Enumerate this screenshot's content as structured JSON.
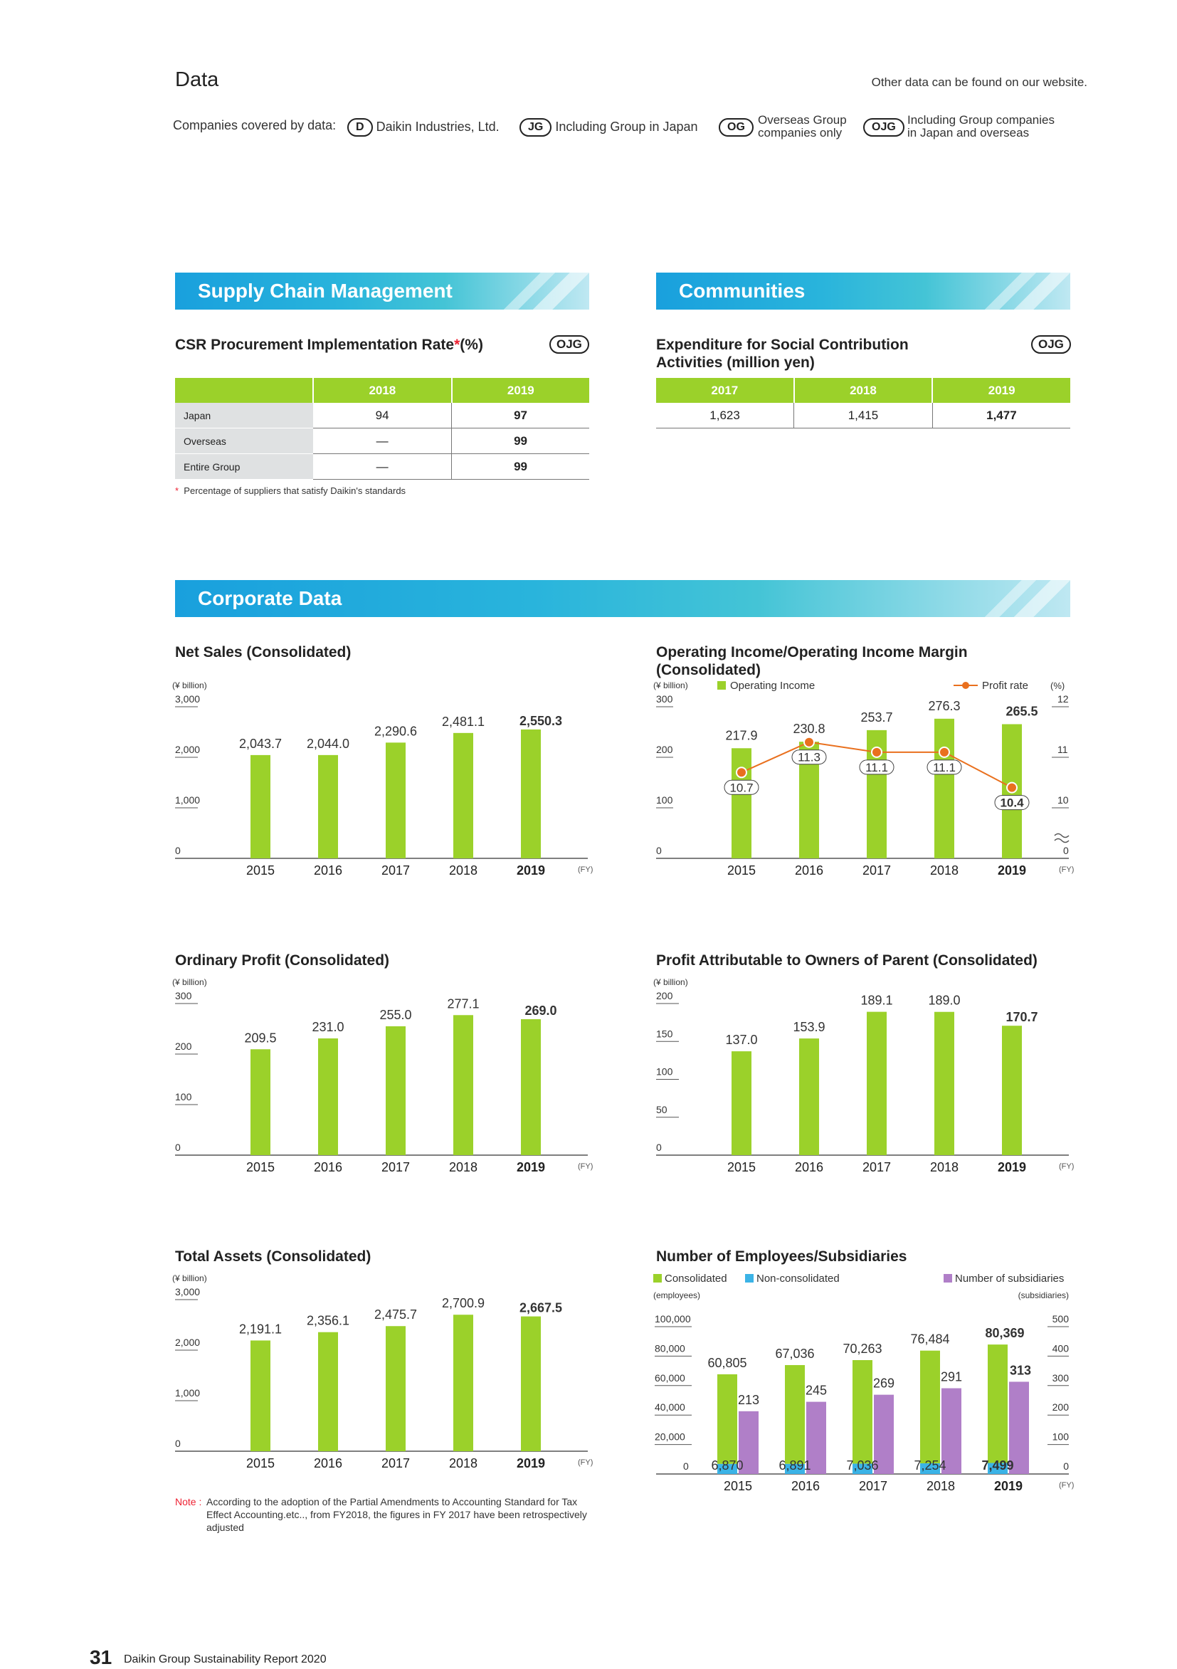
{
  "header": {
    "title": "Data",
    "website_note": "Other data can be found on our website.",
    "coverage_label": "Companies covered by data:",
    "legend": [
      {
        "badge": "D",
        "text": "Daikin Industries, Ltd."
      },
      {
        "badge": "JG",
        "text": "Including Group in Japan"
      },
      {
        "badge": "OG",
        "text1": "Overseas Group",
        "text2": "companies only"
      },
      {
        "badge": "OJG",
        "text1": "Including Group companies",
        "text2": "in Japan and overseas"
      }
    ]
  },
  "supply_chain": {
    "banner": "Supply Chain Management",
    "title": "CSR Procurement Implementation Rate",
    "title_ast": "*",
    "title_unit": "(%)",
    "badge": "OJG",
    "columns": [
      "2018",
      "2019"
    ],
    "rows": [
      {
        "label": "Japan",
        "v2018": "94",
        "v2019": "97"
      },
      {
        "label": "Overseas",
        "v2018": "—",
        "v2019": "99"
      },
      {
        "label": "Entire Group",
        "v2018": "—",
        "v2019": "99"
      }
    ],
    "footnote_ast": "*",
    "footnote": "Percentage of suppliers that satisfy Daikin's standards"
  },
  "communities": {
    "banner": "Communities",
    "title_line1": "Expenditure for Social Contribution",
    "title_line2": "Activities (million yen)",
    "badge": "OJG",
    "columns": [
      "2017",
      "2018",
      "2019"
    ],
    "values": [
      "1,623",
      "1,415",
      "1,477"
    ]
  },
  "corporate": {
    "banner": "Corporate Data",
    "note_label": "Note :",
    "note_line1": "According to the adoption of the Partial Amendments to Accounting Standard for Tax",
    "note_line2": "Effect Accounting.etc.., from FY2018, the figures in FY 2017 have been retrospectively",
    "note_line3": "adjusted"
  },
  "colors": {
    "green": "#9bd12a",
    "blue": "#3bb3e6",
    "purple": "#b07fc8",
    "orange": "#e9701e"
  },
  "chart_data": [
    {
      "id": "net_sales",
      "type": "bar",
      "title": "Net Sales (Consolidated)",
      "ylabel": "(¥ billion)",
      "xunit": "(FY)",
      "categories": [
        "2015",
        "2016",
        "2017",
        "2018",
        "2019"
      ],
      "values": [
        2043.7,
        2044.0,
        2290.6,
        2481.1,
        2550.3
      ],
      "labels": [
        "2,043.7",
        "2,044.0",
        "2,290.6",
        "2,481.1",
        "2,550.3"
      ],
      "ylim": [
        0,
        3000
      ],
      "yticks": [
        0,
        1000,
        2000,
        3000
      ],
      "ytick_labels": [
        "0",
        "1,000",
        "2,000",
        "3,000"
      ]
    },
    {
      "id": "operating_income",
      "type": "bar+line",
      "title": "Operating Income/Operating Income Margin",
      "title2": "(Consolidated)",
      "ylabel": "(¥ billion)",
      "ylabel_right": "(%)",
      "xunit": "(FY)",
      "bar_legend": "Operating Income",
      "line_legend": "Profit rate",
      "categories": [
        "2015",
        "2016",
        "2017",
        "2018",
        "2019"
      ],
      "values": [
        217.9,
        230.8,
        253.7,
        276.3,
        265.5
      ],
      "labels": [
        "217.9",
        "230.8",
        "253.7",
        "276.3",
        "265.5"
      ],
      "rate": [
        10.7,
        11.3,
        11.1,
        11.1,
        10.4
      ],
      "rate_labels": [
        "10.7",
        "11.3",
        "11.1",
        "11.1",
        "10.4"
      ],
      "ylim": [
        0,
        300
      ],
      "yticks": [
        0,
        100,
        200,
        300
      ],
      "ytick_labels": [
        "0",
        "100",
        "200",
        "300"
      ],
      "ylim_right": [
        9,
        12
      ],
      "yticks_right": [
        10,
        11,
        12
      ],
      "ytick_labels_right": [
        "0",
        "10",
        "11",
        "12"
      ]
    },
    {
      "id": "ordinary_profit",
      "type": "bar",
      "title": "Ordinary Profit (Consolidated)",
      "ylabel": "(¥ billion)",
      "xunit": "(FY)",
      "categories": [
        "2015",
        "2016",
        "2017",
        "2018",
        "2019"
      ],
      "values": [
        209.5,
        231.0,
        255.0,
        277.1,
        269.0
      ],
      "labels": [
        "209.5",
        "231.0",
        "255.0",
        "277.1",
        "269.0"
      ],
      "ylim": [
        0,
        300
      ],
      "yticks": [
        0,
        100,
        200,
        300
      ],
      "ytick_labels": [
        "0",
        "100",
        "200",
        "300"
      ]
    },
    {
      "id": "profit_parent",
      "type": "bar",
      "title": "Profit Attributable to Owners of Parent (Consolidated)",
      "ylabel": "(¥ billion)",
      "xunit": "(FY)",
      "categories": [
        "2015",
        "2016",
        "2017",
        "2018",
        "2019"
      ],
      "values": [
        137.0,
        153.9,
        189.1,
        189.0,
        170.7
      ],
      "labels": [
        "137.0",
        "153.9",
        "189.1",
        "189.0",
        "170.7"
      ],
      "ylim": [
        0,
        200
      ],
      "yticks": [
        0,
        50,
        100,
        150,
        200
      ],
      "ytick_labels": [
        "0",
        "50",
        "100",
        "150",
        "200"
      ]
    },
    {
      "id": "total_assets",
      "type": "bar",
      "title": "Total Assets (Consolidated)",
      "ylabel": "(¥ billion)",
      "xunit": "(FY)",
      "categories": [
        "2015",
        "2016",
        "2017",
        "2018",
        "2019"
      ],
      "values": [
        2191.1,
        2356.1,
        2475.7,
        2700.9,
        2667.5
      ],
      "labels": [
        "2,191.1",
        "2,356.1",
        "2,475.7",
        "2,700.9",
        "2,667.5"
      ],
      "ylim": [
        0,
        3000
      ],
      "yticks": [
        0,
        1000,
        2000,
        3000
      ],
      "ytick_labels": [
        "0",
        "1,000",
        "2,000",
        "3,000"
      ]
    },
    {
      "id": "employees",
      "type": "stacked_bar+bar",
      "title": "Number of Employees/Subsidiaries",
      "ylabel": "(employees)",
      "ylabel_right": "(subsidiaries)",
      "xunit": "(FY)",
      "categories": [
        "2015",
        "2016",
        "2017",
        "2018",
        "2019"
      ],
      "series": [
        {
          "name": "Consolidated",
          "values": [
            60805,
            67036,
            70263,
            76484,
            80369
          ],
          "labels": [
            "60,805",
            "67,036",
            "70,263",
            "76,484",
            "80,369"
          ]
        },
        {
          "name": "Non-consolidated",
          "values": [
            6870,
            6891,
            7036,
            7254,
            7499
          ],
          "labels": [
            "6,870",
            "6,891",
            "7,036",
            "7,254",
            "7,499"
          ]
        },
        {
          "name": "Number of subsidiaries",
          "values": [
            213,
            245,
            269,
            291,
            313
          ],
          "labels": [
            "213",
            "245",
            "269",
            "291",
            "313"
          ]
        }
      ],
      "ylim": [
        0,
        100000
      ],
      "yticks": [
        0,
        20000,
        40000,
        60000,
        80000,
        100000
      ],
      "ytick_labels": [
        "0",
        "20,000",
        "40,000",
        "60,000",
        "80,000",
        "100,000"
      ],
      "ylim_right": [
        0,
        500
      ],
      "yticks_right": [
        0,
        100,
        200,
        300,
        400,
        500
      ],
      "ytick_labels_right": [
        "0",
        "100",
        "200",
        "300",
        "400",
        "500"
      ]
    }
  ],
  "footer": {
    "page_number": "31",
    "text": "Daikin Group Sustainability Report 2020"
  }
}
